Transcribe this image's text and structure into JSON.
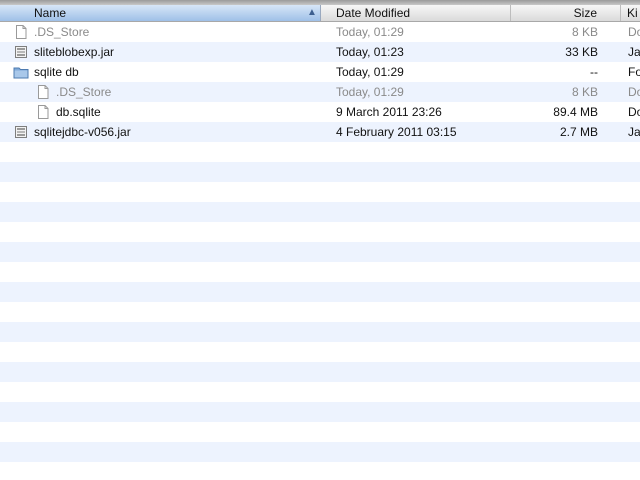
{
  "columns": {
    "name": "Name",
    "date": "Date Modified",
    "size": "Size",
    "kind": "Ki"
  },
  "files": [
    {
      "name": ".DS_Store",
      "date": "Today, 01:29",
      "size": "8 KB",
      "kind": "Do",
      "icon": "document-icon",
      "indent": 0,
      "dim": true
    },
    {
      "name": "sliteblobexp.jar",
      "date": "Today, 01:23",
      "size": "33 KB",
      "kind": "Jav",
      "icon": "jar-icon",
      "indent": 0,
      "dim": false
    },
    {
      "name": "sqlite db",
      "date": "Today, 01:29",
      "size": "--",
      "kind": "Fo",
      "icon": "folder-icon",
      "indent": 0,
      "dim": false
    },
    {
      "name": ".DS_Store",
      "date": "Today, 01:29",
      "size": "8 KB",
      "kind": "Do",
      "icon": "document-icon",
      "indent": 1,
      "dim": true
    },
    {
      "name": "db.sqlite",
      "date": "9 March 2011 23:26",
      "size": "89.4 MB",
      "kind": "Do",
      "icon": "document-icon",
      "indent": 1,
      "dim": false
    },
    {
      "name": "sqlitejdbc-v056.jar",
      "date": "4 February 2011 03:15",
      "size": "2.7 MB",
      "kind": "Jav",
      "icon": "jar-icon",
      "indent": 0,
      "dim": false
    }
  ]
}
